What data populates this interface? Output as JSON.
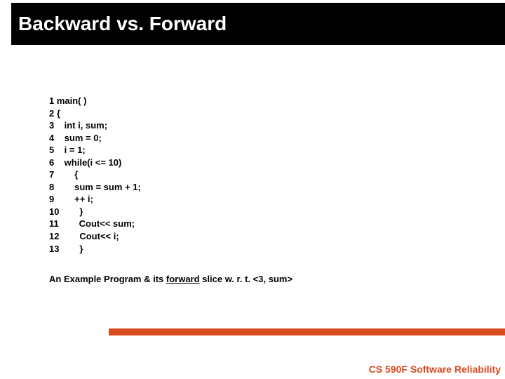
{
  "title": "Backward vs. Forward",
  "code": {
    "l1": "1 main( )",
    "l2": "2 {",
    "l3": "3    int i, sum;",
    "l4": "4    sum = 0;",
    "l5": "5    i = 1;",
    "l6": "6    while(i <= 10)",
    "l7": "7        {",
    "l8": "8        sum = sum + 1;",
    "l9": "9        ++ i;",
    "l10": "10        }",
    "l11": "11        Cout<< sum;",
    "l12": "12        Cout<< i;",
    "l13": "13        }"
  },
  "caption_prefix": "An Example Program & its ",
  "caption_underlined": "forward",
  "caption_suffix": " slice w. r. t. <3, sum>",
  "footer": "CS 590F Software Reliability"
}
